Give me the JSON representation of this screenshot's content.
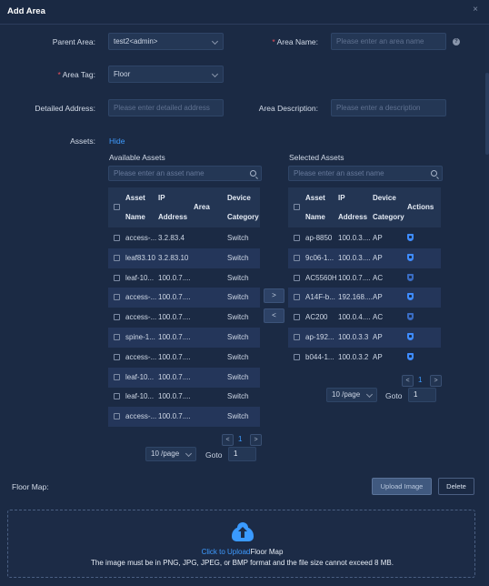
{
  "dialog": {
    "title": "Add Area",
    "close": "×"
  },
  "form": {
    "parent_area_label": "Parent Area:",
    "parent_area_value": "test2<admin>",
    "area_name_label": "Area Name:",
    "area_name_placeholder": "Please enter an area name",
    "area_tag_label": "Area Tag:",
    "area_tag_value": "Floor",
    "detailed_address_label": "Detailed Address:",
    "detailed_address_placeholder": "Please enter detailed address",
    "area_description_label": "Area Description:",
    "area_description_placeholder": "Please enter a description",
    "assets_label": "Assets:",
    "assets_toggle": "Hide",
    "help_glyph": "?"
  },
  "available": {
    "title": "Available Assets",
    "search_placeholder": "Please enter an asset name",
    "columns": [
      "Asset Name",
      "IP Address",
      "Area",
      "Device Category"
    ],
    "rows": [
      {
        "name": "access-...",
        "ip": "3.2.83.4",
        "area": "",
        "cat": "Switch"
      },
      {
        "name": "leaf83.10",
        "ip": "3.2.83.10",
        "area": "",
        "cat": "Switch"
      },
      {
        "name": "leaf-10...",
        "ip": "100.0.7....",
        "area": "",
        "cat": "Switch"
      },
      {
        "name": "access-...",
        "ip": "100.0.7....",
        "area": "",
        "cat": "Switch"
      },
      {
        "name": "access-...",
        "ip": "100.0.7....",
        "area": "",
        "cat": "Switch"
      },
      {
        "name": "spine-1...",
        "ip": "100.0.7....",
        "area": "",
        "cat": "Switch"
      },
      {
        "name": "access-...",
        "ip": "100.0.7....",
        "area": "",
        "cat": "Switch"
      },
      {
        "name": "leaf-10...",
        "ip": "100.0.7....",
        "area": "",
        "cat": "Switch"
      },
      {
        "name": "leaf-10...",
        "ip": "100.0.7....",
        "area": "",
        "cat": "Switch"
      },
      {
        "name": "access-...",
        "ip": "100.0.7....",
        "area": "",
        "cat": "Switch"
      }
    ],
    "page": "1",
    "page_size": "10 /page",
    "goto_label": "Goto",
    "goto_value": "1"
  },
  "selected": {
    "title": "Selected Assets",
    "search_placeholder": "Please enter an asset name",
    "columns": [
      "Asset Name",
      "IP Address",
      "Device Category",
      "Actions"
    ],
    "rows": [
      {
        "name": "ap-8850",
        "ip": "100.0.3....",
        "cat": "AP"
      },
      {
        "name": "9c06-1...",
        "ip": "100.0.3....",
        "cat": "AP"
      },
      {
        "name": "AC5560H",
        "ip": "100.0.7....",
        "cat": "AC"
      },
      {
        "name": "A14F-b...",
        "ip": "192.168....",
        "cat": "AP"
      },
      {
        "name": "AC200",
        "ip": "100.0.4....",
        "cat": "AC"
      },
      {
        "name": "ap-192...",
        "ip": "100.0.3.3",
        "cat": "AP"
      },
      {
        "name": "b044-1...",
        "ip": "100.0.3.2",
        "cat": "AP"
      }
    ],
    "page": "1",
    "page_size": "10 /page",
    "goto_label": "Goto",
    "goto_value": "1"
  },
  "transfer": {
    "right": ">",
    "left": "<"
  },
  "pager": {
    "prev": "<",
    "next": ">"
  },
  "floor_map": {
    "label": "Floor Map:",
    "upload_button": "Upload Image",
    "delete_button": "Delete",
    "click_to_upload": "Click to Upload",
    "upload_target": "Floor Map",
    "hint": "The image must be in PNG, JPG, JPEG, or BMP format and the file size cannot exceed 8 MB."
  },
  "colors": {
    "accent": "#3e9bff",
    "background": "#1b2a44",
    "required": "#e8505b"
  }
}
